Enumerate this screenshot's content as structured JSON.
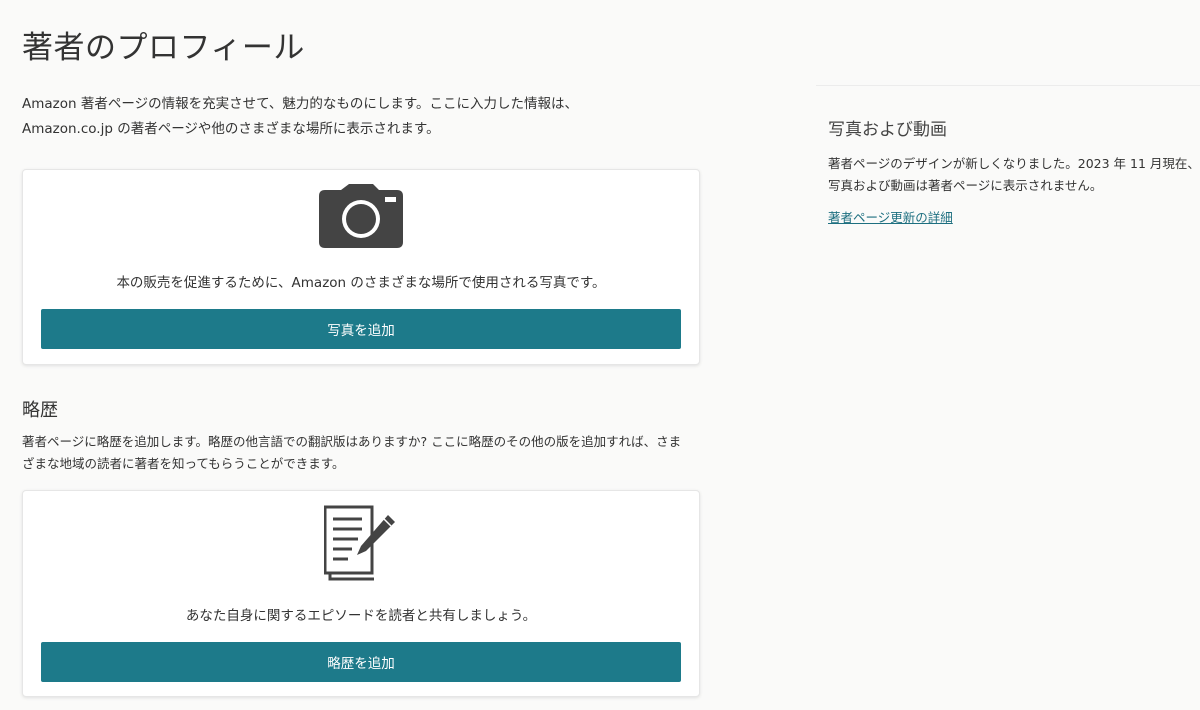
{
  "page": {
    "title": "著者のプロフィール",
    "intro_line1": "Amazon 著者ページの情報を充実させて、魅力的なものにします。ここに入力した情報は、",
    "intro_line2": "Amazon.co.jp の著者ページや他のさまざまな場所に表示されます。"
  },
  "photo_card": {
    "icon": "camera-icon",
    "text": "本の販売を促進するために、Amazon のさまざまな場所で使用される写真です。",
    "button_label": "写真を追加"
  },
  "bio_section": {
    "title": "略歴",
    "desc_line1": "著者ページに略歴を追加します。略歴の他言語での翻訳版はありますか? ここに略歴のその他の版を追加すれば、さま",
    "desc_line2": "ざまな地域の読者に著者を知ってもらうことができます。"
  },
  "bio_card": {
    "icon": "document-pen-icon",
    "text": "あなた自身に関するエピソードを読者と共有しましょう。",
    "button_label": "略歴を追加"
  },
  "sidebar": {
    "title": "写真および動画",
    "desc_line1": "著者ページのデザインが新しくなりました。2023 年 11 月現在、",
    "desc_line2": "写真および動画は著者ページに表示されません。",
    "link_label": "著者ページ更新の詳細"
  },
  "colors": {
    "accent_button": "#1d7a8a",
    "link": "#1d6f80",
    "icon": "#444444",
    "background": "#fafaf9"
  }
}
